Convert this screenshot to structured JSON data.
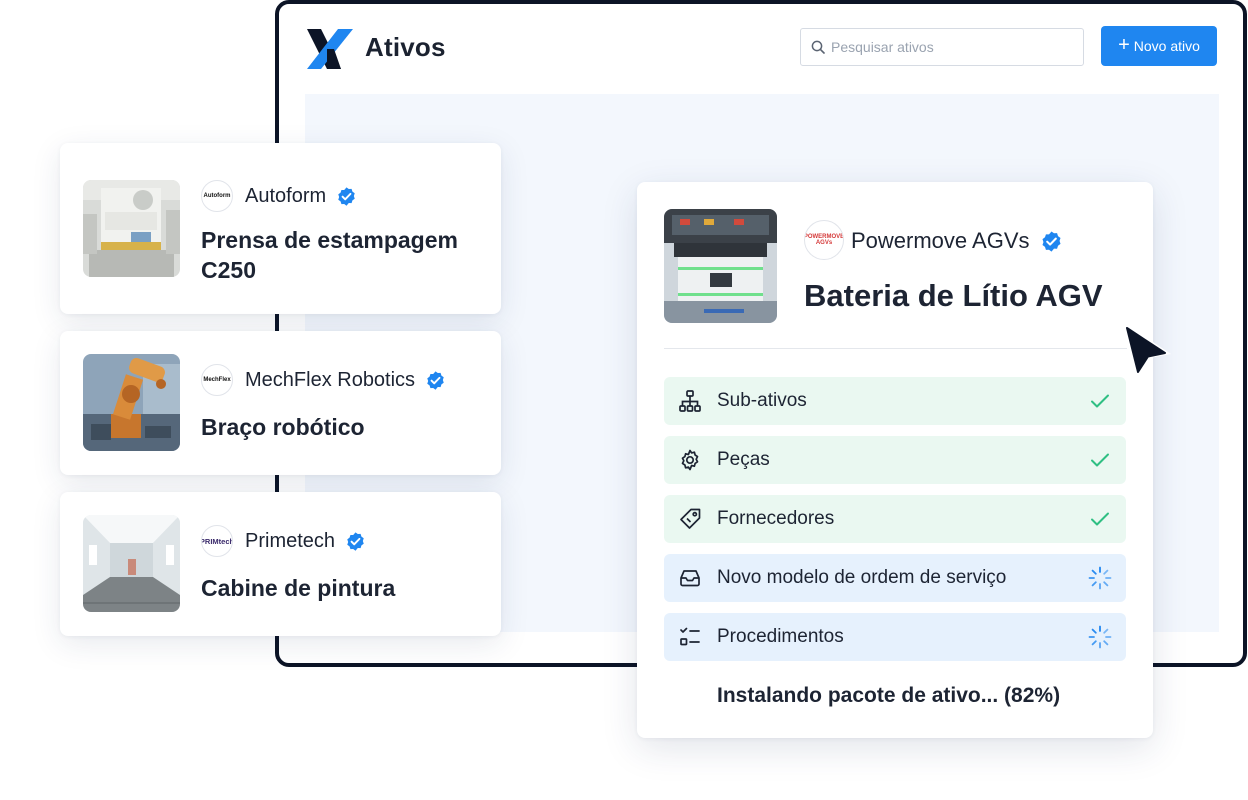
{
  "app": {
    "title": "Ativos",
    "search_placeholder": "Pesquisar ativos",
    "new_button_label": "Novo ativo",
    "brand_color": "#1f86f0",
    "logo_icon": "x-logo-icon"
  },
  "asset_list": [
    {
      "vendor": "Autoform",
      "vendor_logo_text": "Autoform",
      "verified": true,
      "title": "Prensa de estampagem C250",
      "thumb_icon": "stamping-press-photo"
    },
    {
      "vendor": "MechFlex Robotics",
      "vendor_logo_text": "MechFlex",
      "verified": true,
      "title": "Braço robótico",
      "thumb_icon": "robot-arm-photo"
    },
    {
      "vendor": "Primetech",
      "vendor_logo_text": "PRIMtech",
      "verified": true,
      "title": "Cabine de pintura",
      "thumb_icon": "paint-booth-photo"
    }
  ],
  "detail": {
    "vendor": "Powermove AGVs",
    "vendor_logo_text": "POWERMOVE AGVs",
    "verified": true,
    "title": "Bateria de Lítio AGV",
    "thumb_icon": "agv-battery-photo",
    "steps": [
      {
        "label": "Sub-ativos",
        "icon": "hierarchy-icon",
        "status": "done"
      },
      {
        "label": "Peças",
        "icon": "gear-icon",
        "status": "done"
      },
      {
        "label": "Fornecedores",
        "icon": "tag-icon",
        "status": "done"
      },
      {
        "label": "Novo modelo de ordem de serviço",
        "icon": "inbox-icon",
        "status": "loading"
      },
      {
        "label": "Procedimentos",
        "icon": "checklist-icon",
        "status": "loading"
      }
    ],
    "install_status": "Instalando pacote de ativo... (82%)",
    "install_progress": 0.82
  },
  "colors": {
    "done_bg": "#eaf8f1",
    "done_check": "#2fbf83",
    "loading_bg": "#e6f1fd",
    "loading_spinner": "#1f86f0",
    "verified_badge": "#1f86f0",
    "dark": "#0c1426"
  }
}
